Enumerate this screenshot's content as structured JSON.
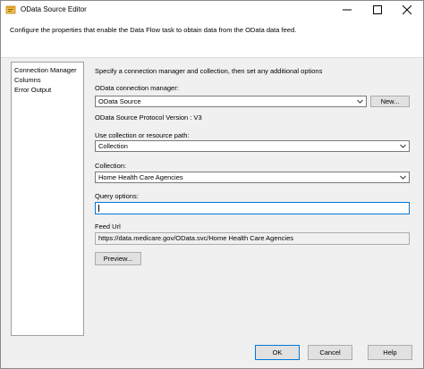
{
  "window": {
    "title": "OData Source Editor",
    "controls": {
      "minimize": "minimize-icon",
      "maximize": "maximize-icon",
      "close": "close-icon"
    }
  },
  "description": "Configure the properties that enable the Data Flow task to obtain data from the OData data feed.",
  "nav": {
    "items": [
      {
        "label": "Connection Manager",
        "selected": true
      },
      {
        "label": "Columns"
      },
      {
        "label": "Error Output"
      }
    ]
  },
  "content": {
    "instructions": "Specify a connection manager and collection, then set any additional options",
    "connection_manager": {
      "label": "OData connection manager:",
      "value": "OData Source",
      "new_button": "New..."
    },
    "protocol_version": "OData Source Protocol Version : V3",
    "use_path": {
      "label": "Use collection or resource path:",
      "value": "Collection"
    },
    "collection": {
      "label": "Collection:",
      "value": "Home Health Care Agencies"
    },
    "query_options": {
      "label": "Query options:",
      "value": ""
    },
    "feed_url": {
      "label": "Feed Url",
      "value": "https://data.medicare.gov/OData.svc/Home Health Care Agencies"
    },
    "preview_button": "Preview..."
  },
  "footer": {
    "ok": "OK",
    "cancel": "Cancel",
    "help": "Help"
  },
  "colors": {
    "accent": "#0078d7",
    "panel": "#f0f0f0",
    "button": "#e1e1e1"
  }
}
